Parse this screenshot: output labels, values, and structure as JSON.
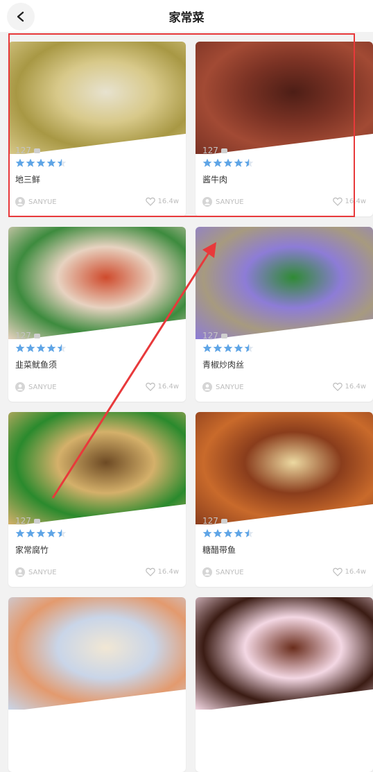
{
  "header": {
    "title": "家常菜"
  },
  "cards": [
    {
      "name": "地三鲜",
      "comments": "127",
      "author": "SANYUE",
      "likes": "16.4w",
      "rating": 4.5,
      "colors": [
        "#d8c98a",
        "#a89844",
        "#e7e2cf"
      ]
    },
    {
      "name": "酱牛肉",
      "comments": "127",
      "author": "SANYUE",
      "likes": "16.4w",
      "rating": 4.5,
      "colors": [
        "#7a3224",
        "#a24a34",
        "#4d1e16"
      ]
    },
    {
      "name": "韭菜鱿鱼须",
      "comments": "127",
      "author": "SANYUE",
      "likes": "16.4w",
      "rating": 4.5,
      "colors": [
        "#e7d2c0",
        "#3d8b3e",
        "#cf4a2c"
      ]
    },
    {
      "name": "青椒炒肉丝",
      "comments": "127",
      "author": "SANYUE",
      "likes": "16.4w",
      "rating": 4.5,
      "colors": [
        "#8d7cd7",
        "#a79a7f",
        "#2f8b34"
      ]
    },
    {
      "name": "家常腐竹",
      "comments": "127",
      "author": "SANYUE",
      "likes": "16.4w",
      "rating": 4.5,
      "colors": [
        "#d4b06a",
        "#2a8a2d",
        "#6d4a24"
      ]
    },
    {
      "name": "糖醋带鱼",
      "comments": "127",
      "author": "SANYUE",
      "likes": "16.4w",
      "rating": 4.5,
      "colors": [
        "#8a3d1c",
        "#c96a2b",
        "#ecd9a1"
      ]
    },
    {
      "name": "",
      "comments": "",
      "author": "",
      "likes": "",
      "rating": 0,
      "colors": [
        "#c9d5e8",
        "#e39a6e",
        "#f1e7d4"
      ]
    },
    {
      "name": "",
      "comments": "",
      "author": "",
      "likes": "",
      "rating": 0,
      "colors": [
        "#f3d7e3",
        "#3b1c14",
        "#6a2d1c"
      ]
    }
  ],
  "annotation_color": "#e8393b"
}
